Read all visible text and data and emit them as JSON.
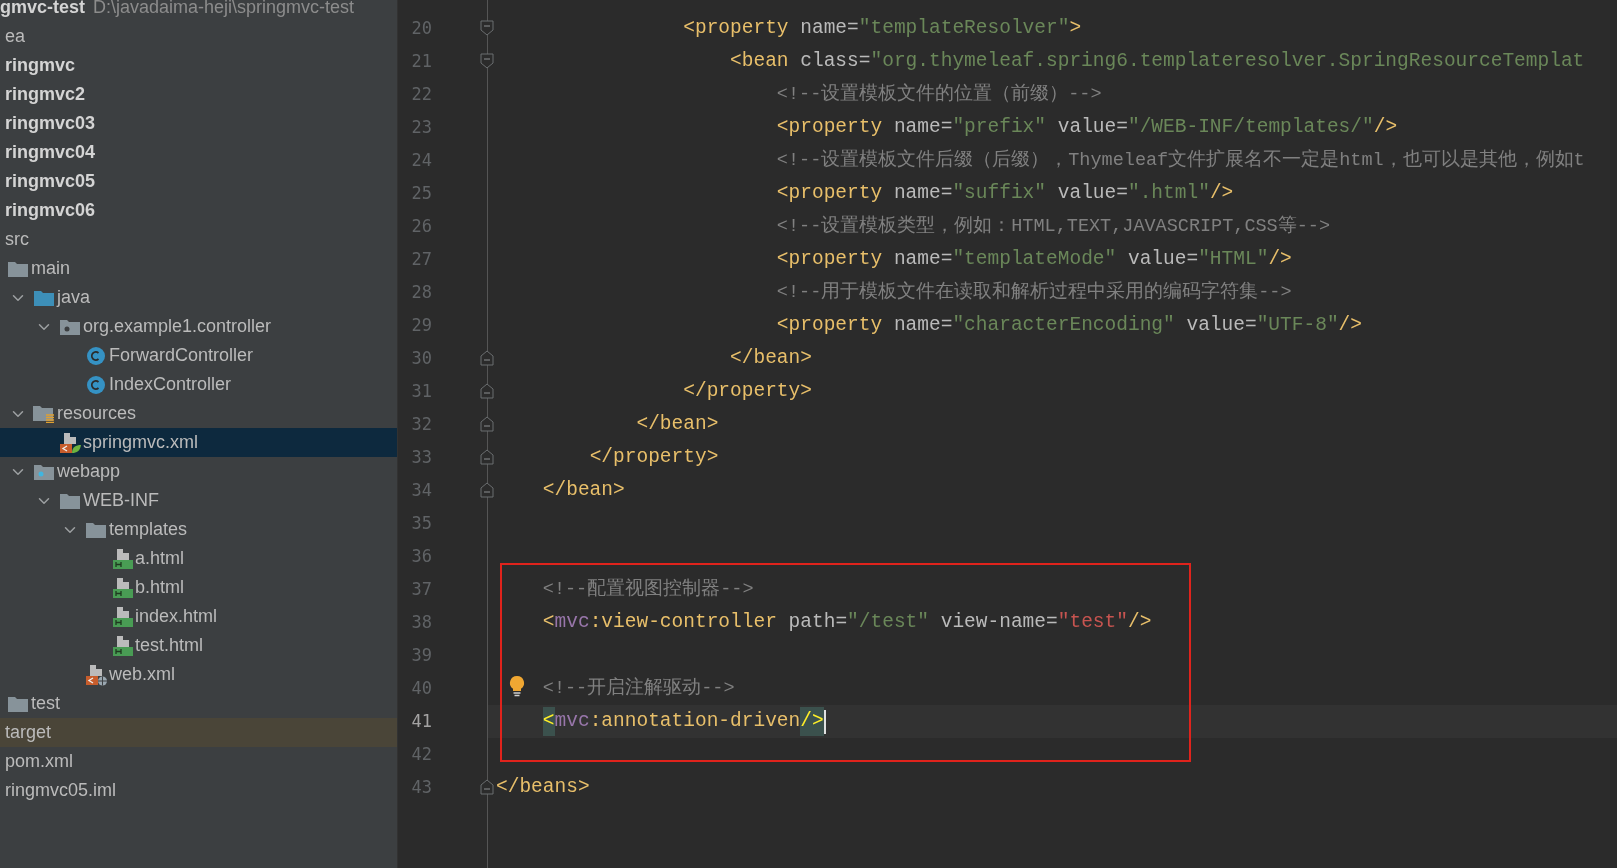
{
  "project": {
    "name": "gmvc-test",
    "path": "D:\\javadaima-heji\\springmvc-test"
  },
  "tree": [
    {
      "label": "ea",
      "kind": "item",
      "selected": false
    },
    {
      "label": "ringmvc",
      "kind": "module",
      "selected": false
    },
    {
      "label": "ringmvc2",
      "kind": "module",
      "selected": false
    },
    {
      "label": "ringmvc03",
      "kind": "module",
      "selected": false
    },
    {
      "label": "ringmvc04",
      "kind": "module",
      "selected": false
    },
    {
      "label": "ringmvc05",
      "kind": "module",
      "selected": false
    },
    {
      "label": "ringmvc06",
      "kind": "module",
      "selected": false
    },
    {
      "label": "src",
      "kind": "item",
      "selected": false,
      "children": [
        {
          "label": "main",
          "kind": "folder",
          "selected": false,
          "children": [
            {
              "label": "java",
              "kind": "sources",
              "expanded": true,
              "selected": false,
              "children": [
                {
                  "label": "org.example1.controller",
                  "kind": "package",
                  "expanded": true,
                  "selected": false,
                  "children": [
                    {
                      "label": "ForwardController",
                      "kind": "class",
                      "selected": false
                    },
                    {
                      "label": "IndexController",
                      "kind": "class",
                      "selected": false
                    }
                  ]
                }
              ]
            },
            {
              "label": "resources",
              "kind": "resources",
              "expanded": true,
              "selected": false,
              "children": [
                {
                  "label": "springmvc.xml",
                  "kind": "springxml",
                  "selected": true
                }
              ]
            },
            {
              "label": "webapp",
              "kind": "webroot",
              "expanded": true,
              "selected": false,
              "children": [
                {
                  "label": "WEB-INF",
                  "kind": "folder",
                  "expanded": true,
                  "selected": false,
                  "children": [
                    {
                      "label": "templates",
                      "kind": "folder",
                      "expanded": true,
                      "selected": false,
                      "children": [
                        {
                          "label": "a.html",
                          "kind": "html",
                          "selected": false
                        },
                        {
                          "label": "b.html",
                          "kind": "html",
                          "selected": false
                        },
                        {
                          "label": "index.html",
                          "kind": "html",
                          "selected": false
                        },
                        {
                          "label": "test.html",
                          "kind": "html",
                          "selected": false
                        }
                      ]
                    },
                    {
                      "label": "web.xml",
                      "kind": "webxml",
                      "selected": false
                    }
                  ]
                }
              ]
            }
          ]
        },
        {
          "label": "test",
          "kind": "folder",
          "selected": false
        }
      ]
    },
    {
      "label": "target",
      "kind": "excluded",
      "selected": false
    },
    {
      "label": "pom.xml",
      "kind": "item",
      "selected": false
    },
    {
      "label": "ringmvc05.iml",
      "kind": "item",
      "selected": false
    }
  ],
  "editor": {
    "lines": [
      {
        "number": "20",
        "current": false,
        "kind": "foldstart",
        "tokens": [
          {
            "kind": "tag",
            "s": "                <property"
          },
          {
            "kind": "attr",
            "s": " name"
          },
          {
            "kind": "eq",
            "s": "="
          },
          {
            "kind": "str",
            "s": "\"templateResolver\""
          },
          {
            "kind": "tag",
            "s": ">"
          }
        ]
      },
      {
        "number": "21",
        "current": false,
        "kind": "foldstart",
        "tokens": [
          {
            "kind": "tag",
            "s": "                    <bean"
          },
          {
            "kind": "attr",
            "s": " class"
          },
          {
            "kind": "eq",
            "s": "="
          },
          {
            "kind": "str",
            "s": "\"org.thymeleaf.spring6.templateresolver.SpringResourceTemplat"
          }
        ]
      },
      {
        "number": "22",
        "current": false,
        "kind": "plain",
        "tokens": [
          {
            "kind": "comment",
            "s": "                        <!--设置模板文件的位置（前缀）-->"
          }
        ]
      },
      {
        "number": "23",
        "current": false,
        "kind": "plain",
        "tokens": [
          {
            "kind": "tag",
            "s": "                        <property"
          },
          {
            "kind": "attr",
            "s": " name"
          },
          {
            "kind": "eq",
            "s": "="
          },
          {
            "kind": "str",
            "s": "\"prefix\""
          },
          {
            "kind": "attr",
            "s": " value"
          },
          {
            "kind": "eq",
            "s": "="
          },
          {
            "kind": "str",
            "s": "\"/WEB-INF/templates/\""
          },
          {
            "kind": "tag",
            "s": "/>"
          }
        ]
      },
      {
        "number": "24",
        "current": false,
        "kind": "plain",
        "tokens": [
          {
            "kind": "comment",
            "s": "                        <!--设置模板文件后缀（后缀），Thymeleaf文件扩展名不一定是html，也可以是其他，例如t"
          }
        ]
      },
      {
        "number": "25",
        "current": false,
        "kind": "plain",
        "tokens": [
          {
            "kind": "tag",
            "s": "                        <property"
          },
          {
            "kind": "attr",
            "s": " name"
          },
          {
            "kind": "eq",
            "s": "="
          },
          {
            "kind": "str",
            "s": "\"suffix\""
          },
          {
            "kind": "attr",
            "s": " value"
          },
          {
            "kind": "eq",
            "s": "="
          },
          {
            "kind": "str",
            "s": "\".html\""
          },
          {
            "kind": "tag",
            "s": "/>"
          }
        ]
      },
      {
        "number": "26",
        "current": false,
        "kind": "plain",
        "tokens": [
          {
            "kind": "comment",
            "s": "                        <!--设置模板类型，例如：HTML,TEXT,JAVASCRIPT,CSS等-->"
          }
        ]
      },
      {
        "number": "27",
        "current": false,
        "kind": "plain",
        "tokens": [
          {
            "kind": "tag",
            "s": "                        <property"
          },
          {
            "kind": "attr",
            "s": " name"
          },
          {
            "kind": "eq",
            "s": "="
          },
          {
            "kind": "str",
            "s": "\"templateMode\""
          },
          {
            "kind": "attr",
            "s": " value"
          },
          {
            "kind": "eq",
            "s": "="
          },
          {
            "kind": "str",
            "s": "\"HTML\""
          },
          {
            "kind": "tag",
            "s": "/>"
          }
        ]
      },
      {
        "number": "28",
        "current": false,
        "kind": "plain",
        "tokens": [
          {
            "kind": "comment",
            "s": "                        <!--用于模板文件在读取和解析过程中采用的编码字符集-->"
          }
        ]
      },
      {
        "number": "29",
        "current": false,
        "kind": "plain",
        "tokens": [
          {
            "kind": "tag",
            "s": "                        <property"
          },
          {
            "kind": "attr",
            "s": " name"
          },
          {
            "kind": "eq",
            "s": "="
          },
          {
            "kind": "str",
            "s": "\"characterEncoding\""
          },
          {
            "kind": "attr",
            "s": " value"
          },
          {
            "kind": "eq",
            "s": "="
          },
          {
            "kind": "str",
            "s": "\"UTF-8\""
          },
          {
            "kind": "tag",
            "s": "/>"
          }
        ]
      },
      {
        "number": "30",
        "current": false,
        "kind": "foldend",
        "tokens": [
          {
            "kind": "tag",
            "s": "                    </bean>"
          }
        ]
      },
      {
        "number": "31",
        "current": false,
        "kind": "foldend",
        "tokens": [
          {
            "kind": "tag",
            "s": "                </property>"
          }
        ]
      },
      {
        "number": "32",
        "current": false,
        "kind": "foldend",
        "tokens": [
          {
            "kind": "tag",
            "s": "            </bean>"
          }
        ]
      },
      {
        "number": "33",
        "current": false,
        "kind": "foldend",
        "tokens": [
          {
            "kind": "tag",
            "s": "        </property>"
          }
        ]
      },
      {
        "number": "34",
        "current": false,
        "kind": "foldend",
        "tokens": [
          {
            "kind": "tag",
            "s": "    </bean>"
          }
        ]
      },
      {
        "number": "35",
        "current": false,
        "kind": "plain"
      },
      {
        "number": "36",
        "current": false,
        "kind": "plain"
      },
      {
        "number": "37",
        "current": false,
        "kind": "plain",
        "tokens": [
          {
            "kind": "comment",
            "s": "    <!--配置视图控制器-->"
          }
        ]
      },
      {
        "number": "38",
        "current": false,
        "kind": "plain",
        "tokens": [
          {
            "kind": "tag",
            "s": "    <"
          },
          {
            "kind": "ns",
            "s": "mvc"
          },
          {
            "kind": "tag",
            "s": ":view-controller"
          },
          {
            "kind": "attr",
            "s": " path"
          },
          {
            "kind": "eq",
            "s": "="
          },
          {
            "kind": "str",
            "s": "\"/test\""
          },
          {
            "kind": "attr",
            "s": " view-name"
          },
          {
            "kind": "eq",
            "s": "="
          },
          {
            "kind": "ref",
            "s": "\"test\""
          },
          {
            "kind": "tag",
            "s": "/>"
          }
        ]
      },
      {
        "number": "39",
        "current": false,
        "kind": "plain"
      },
      {
        "number": "40",
        "current": false,
        "kind": "bulb",
        "tokens": [
          {
            "kind": "comment",
            "s": "    <!--开启注解驱动-->"
          }
        ]
      },
      {
        "number": "41",
        "current": true,
        "kind": "plain",
        "tokens": [
          {
            "kind": "match",
            "s": "    <"
          },
          {
            "kind": "ns",
            "s": "mvc"
          },
          {
            "kind": "tag",
            "s": ":annotation-driven"
          },
          {
            "kind": "match",
            "s": "/>"
          }
        ]
      },
      {
        "number": "42",
        "current": false,
        "kind": "plain"
      },
      {
        "number": "43",
        "current": false,
        "kind": "foldend",
        "tokens": [
          {
            "kind": "tag",
            "s": "</beans>"
          }
        ]
      }
    ]
  }
}
